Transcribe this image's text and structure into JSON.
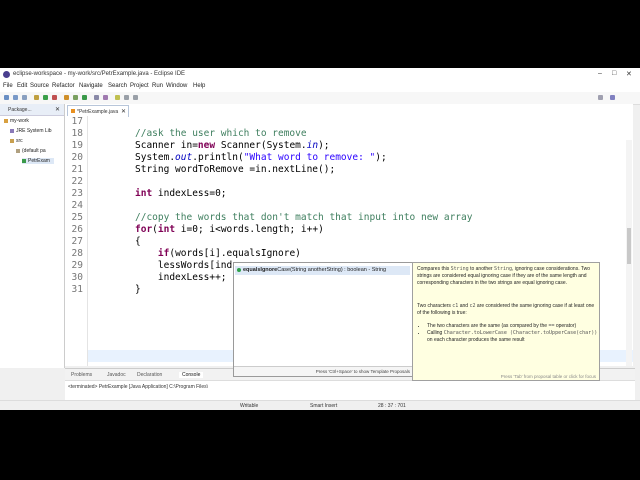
{
  "window": {
    "title": "eclipse-workspace - my-work/src/PetrExample.java - Eclipse IDE"
  },
  "menu": [
    "File",
    "Edit",
    "Source",
    "Refactor",
    "Navigate",
    "Search",
    "Project",
    "Run",
    "Window",
    "Help"
  ],
  "package_explorer": {
    "tab": "Package...",
    "items": [
      {
        "label": "my-work",
        "indent": 0
      },
      {
        "label": "JRE System Lib",
        "indent": 1
      },
      {
        "label": "src",
        "indent": 1
      },
      {
        "label": "(default pa",
        "indent": 2
      },
      {
        "label": "PetrExam",
        "indent": 3
      }
    ]
  },
  "editor": {
    "tab": "*PetrExample.java",
    "lines": [
      {
        "num": "17",
        "text": ""
      },
      {
        "num": "18",
        "text": "//ask the user which to remove"
      },
      {
        "num": "19",
        "text": "Scanner in=new Scanner(System.in);"
      },
      {
        "num": "20",
        "text": "System.out.println(\"What word to remove: \");"
      },
      {
        "num": "21",
        "text": "String wordToRemove =in.nextLine();"
      },
      {
        "num": "22",
        "text": ""
      },
      {
        "num": "23",
        "text": "int indexLess=0;"
      },
      {
        "num": "24",
        "text": ""
      },
      {
        "num": "25",
        "text": "//copy the words that don't match that input into new array"
      },
      {
        "num": "26",
        "text": "for(int i=0; i<words.length; i++)"
      },
      {
        "num": "27",
        "text": "{"
      },
      {
        "num": "28",
        "text": "    if(words[i].equalsIgnore)"
      },
      {
        "num": "29",
        "text": "    lessWords[ind"
      },
      {
        "num": "30",
        "text": "    indexLess++;"
      },
      {
        "num": "31",
        "text": "}"
      }
    ]
  },
  "bottom_panel": {
    "tabs": [
      "Problems",
      "Javadoc",
      "Declaration",
      "Console"
    ],
    "console_line": "<terminated> PetrExample [Java Application] C:\\Program Files\\"
  },
  "status": {
    "writable": "Writable",
    "insert": "Smart Insert",
    "position": "28 : 37 : 701"
  },
  "content_assist": {
    "method_bold": "equalsIgnore",
    "method_rest": "Case(String anotherString) : boolean - String",
    "footer": "Press 'Ctrl+Space' to show Template Proposals"
  },
  "doc_popup": {
    "p1_a": "Compares this ",
    "p1_code1": "String",
    "p1_b": " to another ",
    "p1_code2": "String",
    "p1_c": ", ignoring case considerations. Two strings are considered equal ignoring case if they are of the same length and corresponding characters in the two strings are equal ignoring case.",
    "p2_a": "Two characters ",
    "p2_code1": "c1",
    "p2_b": " and ",
    "p2_code2": "c2",
    "p2_c": " are considered the same ignoring case if at least one of the following is true:",
    "li1_a": "The two characters are the same (as compared by the ",
    "li1_code": "==",
    "li1_b": " operator)",
    "li2_a": "Calling ",
    "li2_code": "Character.toLowerCase (Character.toUpperCase(char))",
    "li2_b": " on each character produces the same result",
    "footer": "Press 'Tab' from proposal table or click for focus"
  },
  "colors": {
    "keyword": "#7f0055",
    "comment": "#3f7f5f",
    "string": "#2a00ff",
    "field": "#0000c0"
  }
}
